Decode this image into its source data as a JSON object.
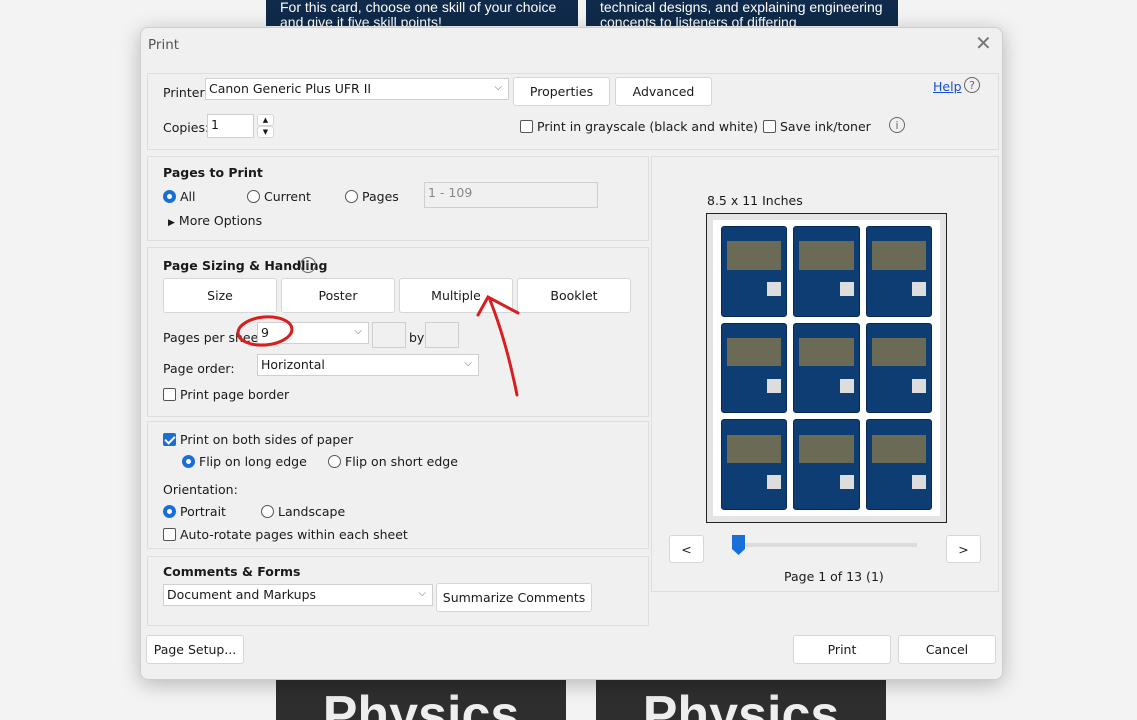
{
  "background": {
    "card_left_text": "For this card, choose one skill of your choice and give it five skill points!",
    "card_right_text": "technical designs, and explaining engineering concepts to listeners of differing backgrounds. I am working to further develop my leadership skills and am challenged to better",
    "bottom_left": "Physics",
    "bottom_right": "Physics"
  },
  "dialog": {
    "title": "Print",
    "close_icon": "close-icon"
  },
  "top": {
    "printer_label": "Printer:",
    "printer_value": "Canon Generic Plus UFR II",
    "properties": "Properties",
    "advanced": "Advanced",
    "help": "Help",
    "copies_label": "Copies:",
    "copies_value": "1",
    "grayscale": "Print in grayscale (black and white)",
    "grayscale_checked": false,
    "save_ink": "Save ink/toner",
    "save_ink_checked": false
  },
  "pages_to_print": {
    "title": "Pages to Print",
    "all": "All",
    "current": "Current",
    "pages": "Pages",
    "selected": "All",
    "range_placeholder": "1 - 109",
    "more_options": "More Options"
  },
  "sizing": {
    "title": "Page Sizing & Handling",
    "tabs": [
      "Size",
      "Poster",
      "Multiple",
      "Booklet"
    ],
    "active_tab": "Multiple",
    "pps_label": "Pages per sheet:",
    "pps_value": "9",
    "by": "by",
    "order_label": "Page order:",
    "order_value": "Horizontal",
    "border": "Print page border",
    "border_checked": false
  },
  "duplex": {
    "both_sides": "Print on both sides of paper",
    "both_sides_checked": true,
    "long": "Flip on long edge",
    "short": "Flip on short edge",
    "selected": "long",
    "orientation_label": "Orientation:",
    "portrait": "Portrait",
    "landscape": "Landscape",
    "orientation": "Portrait",
    "autorotate": "Auto-rotate pages within each sheet",
    "autorotate_checked": false
  },
  "comments": {
    "title": "Comments & Forms",
    "value": "Document and Markups",
    "summarize": "Summarize Comments"
  },
  "preview": {
    "paper": "8.5 x 11 Inches",
    "prev": "<",
    "next": ">",
    "page_status": "Page 1 of 13 (1)",
    "slider_position": "1 of 13"
  },
  "footer": {
    "page_setup": "Page Setup...",
    "print": "Print",
    "cancel": "Cancel"
  },
  "annotation_color": "#d81e1e"
}
